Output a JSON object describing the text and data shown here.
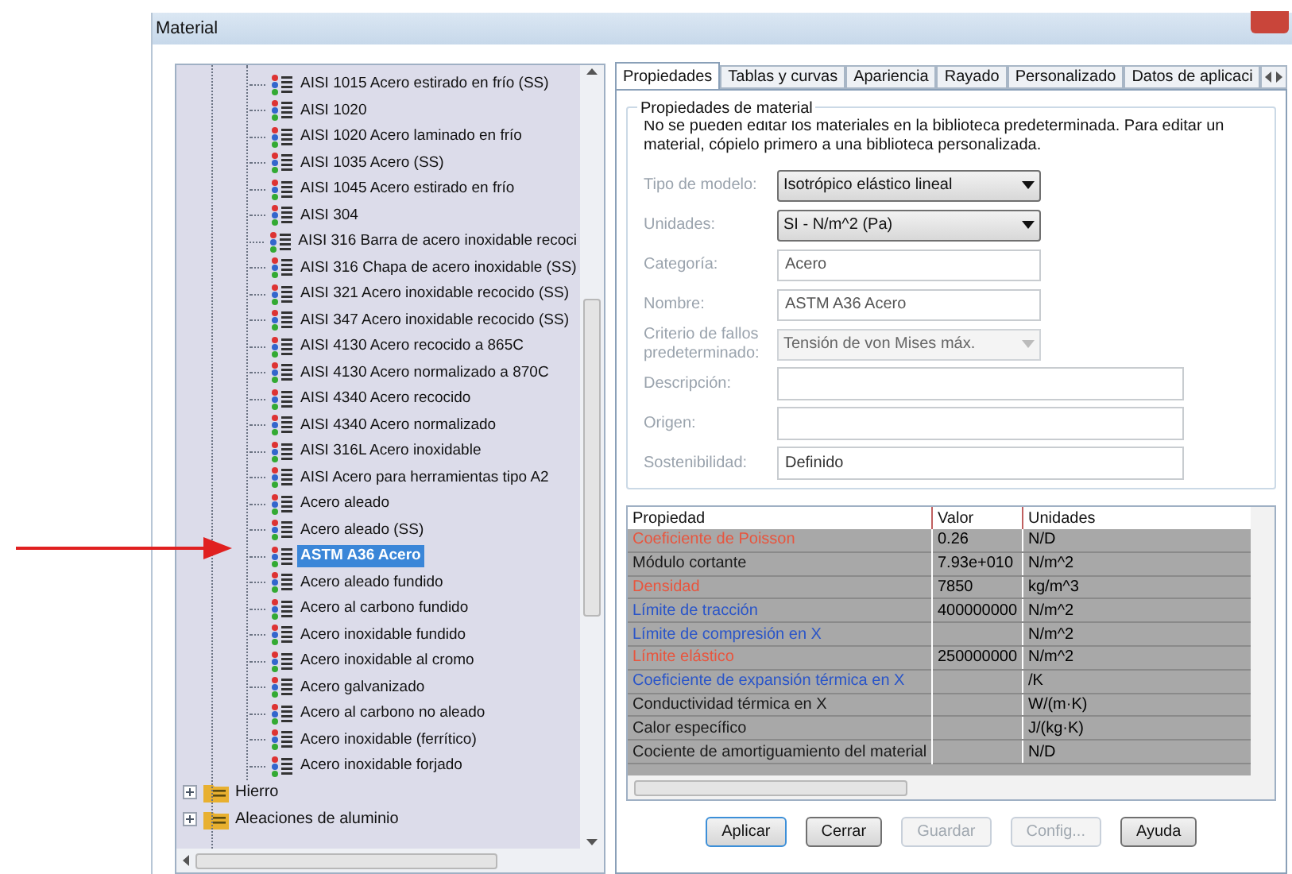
{
  "window": {
    "title": "Material"
  },
  "tree": {
    "items": [
      {
        "kind": "material",
        "label": "AISI 1015 Acero estirado en frío (SS)",
        "selected": false
      },
      {
        "kind": "material",
        "label": "AISI 1020",
        "selected": false
      },
      {
        "kind": "material",
        "label": "AISI 1020 Acero laminado en frío",
        "selected": false
      },
      {
        "kind": "material",
        "label": "AISI 1035 Acero (SS)",
        "selected": false
      },
      {
        "kind": "material",
        "label": "AISI 1045 Acero estirado en frío",
        "selected": false
      },
      {
        "kind": "material",
        "label": "AISI 304",
        "selected": false
      },
      {
        "kind": "material",
        "label": "AISI 316 Barra de acero inoxidable recoci",
        "selected": false
      },
      {
        "kind": "material",
        "label": "AISI 316 Chapa de acero inoxidable (SS)",
        "selected": false
      },
      {
        "kind": "material",
        "label": "AISI 321 Acero inoxidable recocido (SS)",
        "selected": false
      },
      {
        "kind": "material",
        "label": "AISI 347 Acero inoxidable recocido (SS)",
        "selected": false
      },
      {
        "kind": "material",
        "label": "AISI 4130 Acero recocido a 865C",
        "selected": false
      },
      {
        "kind": "material",
        "label": "AISI 4130 Acero normalizado a 870C",
        "selected": false
      },
      {
        "kind": "material",
        "label": "AISI 4340 Acero recocido",
        "selected": false
      },
      {
        "kind": "material",
        "label": "AISI 4340 Acero normalizado",
        "selected": false
      },
      {
        "kind": "material",
        "label": "AISI 316L Acero inoxidable",
        "selected": false
      },
      {
        "kind": "material",
        "label": "AISI Acero para herramientas tipo A2",
        "selected": false
      },
      {
        "kind": "material",
        "label": "Acero aleado",
        "selected": false
      },
      {
        "kind": "material",
        "label": "Acero aleado (SS)",
        "selected": false
      },
      {
        "kind": "material",
        "label": "ASTM A36 Acero",
        "selected": true
      },
      {
        "kind": "material",
        "label": "Acero aleado fundido",
        "selected": false
      },
      {
        "kind": "material",
        "label": "Acero al carbono fundido",
        "selected": false
      },
      {
        "kind": "material",
        "label": "Acero inoxidable fundido",
        "selected": false
      },
      {
        "kind": "material",
        "label": "Acero inoxidable al cromo",
        "selected": false
      },
      {
        "kind": "material",
        "label": "Acero galvanizado",
        "selected": false
      },
      {
        "kind": "material",
        "label": "Acero al carbono no aleado",
        "selected": false
      },
      {
        "kind": "material",
        "label": "Acero inoxidable (ferrítico)",
        "selected": false
      },
      {
        "kind": "material",
        "label": "Acero inoxidable forjado",
        "selected": false
      },
      {
        "kind": "folder",
        "label": "Hierro",
        "expanded": false
      },
      {
        "kind": "folder",
        "label": "Aleaciones de aluminio",
        "expanded": false
      }
    ]
  },
  "tabs": [
    {
      "label": "Propiedades",
      "selected": true
    },
    {
      "label": "Tablas y curvas",
      "selected": false
    },
    {
      "label": "Apariencia",
      "selected": false
    },
    {
      "label": "Rayado",
      "selected": false
    },
    {
      "label": "Personalizado",
      "selected": false
    },
    {
      "label": "Datos de aplicaci",
      "selected": false
    }
  ],
  "properties": {
    "group_title": "Propiedades de material",
    "note": "No se pueden editar los materiales en la biblioteca predeterminada. Para editar un material, cópielo primero a una biblioteca personalizada.",
    "fields": [
      {
        "kind": "select",
        "label": "Tipo de modelo:",
        "value": "Isotrópico elástico lineal",
        "disabled": false
      },
      {
        "kind": "select",
        "label": "Unidades:",
        "value": "SI - N/m^2 (Pa)",
        "disabled": false
      },
      {
        "kind": "input",
        "label": "Categoría:",
        "value": "Acero"
      },
      {
        "kind": "input",
        "label": "Nombre:",
        "value": "ASTM A36 Acero"
      },
      {
        "kind": "select",
        "label": "Criterio de fallos predeterminado:",
        "value": "Tensión de von Mises máx.",
        "disabled": true
      },
      {
        "kind": "wide",
        "label": "Descripción:"
      },
      {
        "kind": "wide",
        "label": "Origen:"
      },
      {
        "kind": "wide",
        "label": "Sostenibilidad:",
        "value": "Definido"
      }
    ]
  },
  "table": {
    "columns": [
      "Propiedad",
      "Valor",
      "Unidades"
    ],
    "rows": [
      {
        "name": "Coeficiente de Poisson",
        "color": "#e8553e",
        "value": "0.26",
        "unit": "N/D"
      },
      {
        "name": "Módulo cortante",
        "color": "#1a1a1a",
        "value": "7.93e+010",
        "unit": "N/m^2"
      },
      {
        "name": "Densidad",
        "color": "#e8553e",
        "value": "7850",
        "unit": "kg/m^3"
      },
      {
        "name": "Límite de tracción",
        "color": "#2a55c8",
        "value": "400000000",
        "unit": "N/m^2"
      },
      {
        "name": "Límite de compresión en X",
        "color": "#2a55c8",
        "unit": "N/m^2"
      },
      {
        "name": "Límite elástico",
        "color": "#e8553e",
        "value": "250000000",
        "unit": "N/m^2"
      },
      {
        "name": "Coeficiente de expansión térmica en X",
        "color": "#2a55c8",
        "unit": "/K"
      },
      {
        "name": "Conductividad térmica en X",
        "color": "#1a1a1a",
        "unit": "W/(m·K)"
      },
      {
        "name": "Calor específico",
        "color": "#1a1a1a",
        "unit": "J/(kg·K)"
      },
      {
        "name": "Cociente de amortiguamiento del material",
        "color": "#1a1a1a",
        "unit": "N/D"
      }
    ]
  },
  "buttons": [
    {
      "label": "Aplicar",
      "disabled": false,
      "default": true
    },
    {
      "label": "Cerrar",
      "disabled": false,
      "default": false
    },
    {
      "label": "Guardar",
      "disabled": true,
      "default": false
    },
    {
      "label": "Config...",
      "disabled": true,
      "default": false
    },
    {
      "label": "Ayuda",
      "disabled": false,
      "default": false
    }
  ]
}
